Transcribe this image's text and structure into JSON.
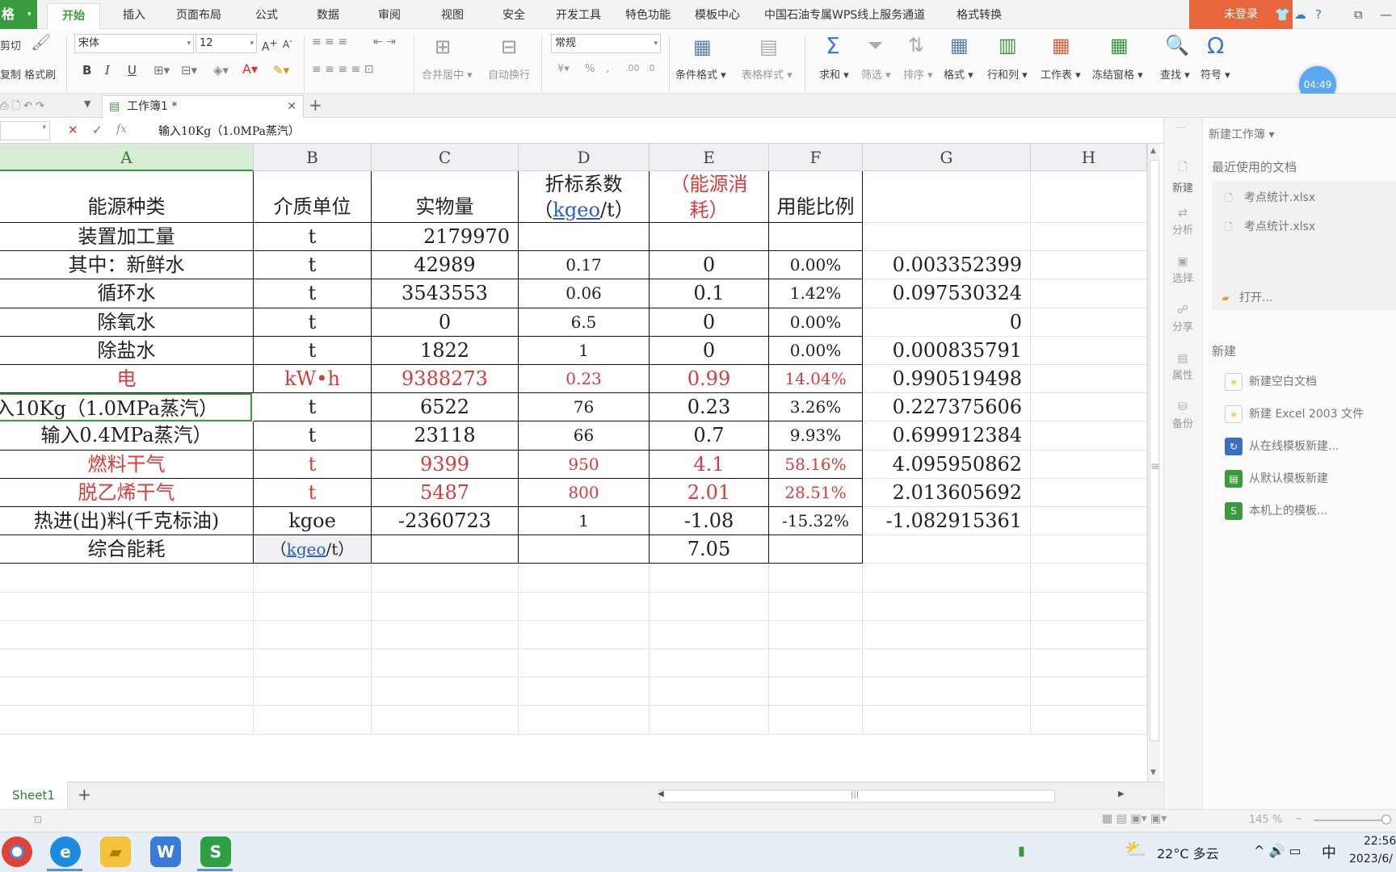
{
  "app": {
    "corner": "格",
    "login": "未登录"
  },
  "menu": [
    "开始",
    "插入",
    "页面布局",
    "公式",
    "数据",
    "审阅",
    "视图",
    "安全",
    "开发工具",
    "特色功能",
    "模板中心",
    "中国石油专属WPS线上服务通道",
    "格式转换"
  ],
  "ribbon": {
    "cut": "剪切",
    "copy": "复制",
    "format_painter": "格式刷",
    "font": "宋体",
    "size": "12",
    "number_format": "常规",
    "merge": "合并居中",
    "wrap": "自动换行",
    "cond_format": "条件格式",
    "table_style": "表格样式",
    "sum": "求和",
    "filter": "筛选",
    "sort": "排序",
    "format": "格式",
    "rowcol": "行和列",
    "sheet": "工作表",
    "freeze": "冻结窗格",
    "find": "查找",
    "symbol": "符号",
    "bold": "B",
    "italic": "I",
    "underline": "U",
    "percent": "%",
    "comma": ","
  },
  "timer": "04:49",
  "tab": {
    "doc_title": "工作簿1 *",
    "add": "+"
  },
  "formula_bar": {
    "fx": "fx",
    "value": "输入10Kg（1.0MPa蒸汽）"
  },
  "columns": [
    "A",
    "B",
    "C",
    "D",
    "E",
    "F",
    "G",
    "H"
  ],
  "header_row": {
    "a": "能源种类",
    "b": "介质单位",
    "c": "实物量",
    "d_line1": "折标系数",
    "d_pre": "（",
    "d_link": "kgeo",
    "d_post": "/t）",
    "e_line1": "（能源消",
    "e_line2": "耗）",
    "f": "用能比例"
  },
  "rows": [
    {
      "a": "装置加工量",
      "b": "t",
      "c": "2179970",
      "d": "",
      "e": "",
      "f": "",
      "g": ""
    },
    {
      "a": "其中：新鲜水",
      "b": "t",
      "c": "42989",
      "d": "0.17",
      "e": "0",
      "f": "0.00%",
      "g": "0.003352399"
    },
    {
      "a": "循环水",
      "b": "t",
      "c": "3543553",
      "d": "0.06",
      "e": "0.1",
      "f": "1.42%",
      "g": "0.097530324"
    },
    {
      "a": "除氧水",
      "b": "t",
      "c": "0",
      "d": "6.5",
      "e": "0",
      "f": "0.00%",
      "g": "0"
    },
    {
      "a": "除盐水",
      "b": "t",
      "c": "1822",
      "d": "1",
      "e": "0",
      "f": "0.00%",
      "g": "0.000835791"
    },
    {
      "a": "电",
      "b": "kW•h",
      "c": "9388273",
      "d": "0.23",
      "e": "0.99",
      "f": "14.04%",
      "g": "0.990519498"
    },
    {
      "a": "输入10Kg（1.0MPa蒸汽）",
      "b": "t",
      "c": "6522",
      "d": "76",
      "e": "0.23",
      "f": "3.26%",
      "g": "0.227375606"
    },
    {
      "a": "输入0.4MPa蒸汽）",
      "b": "t",
      "c": "23118",
      "d": "66",
      "e": "0.7",
      "f": "9.93%",
      "g": "0.699912384"
    },
    {
      "a": "燃料干气",
      "b": "t",
      "c": "9399",
      "d": "950",
      "e": "4.1",
      "f": "58.16%",
      "g": "4.095950862"
    },
    {
      "a": "脱乙烯干气",
      "b": "t",
      "c": "5487",
      "d": "800",
      "e": "2.01",
      "f": "28.51%",
      "g": "2.013605692"
    },
    {
      "a": "热进(出)料(千克标油)",
      "b": "kgoe",
      "c": "-2360723",
      "d": "1",
      "e": "-1.08",
      "f": "-15.32%",
      "g": "-1.082915361"
    }
  ],
  "total_row": {
    "a": "综合能耗",
    "b_pre": "（",
    "b_link": "kgeo",
    "b_post": "/t）",
    "e": "7.05"
  },
  "sheet": {
    "name": "Sheet1",
    "add": "+"
  },
  "status": {
    "zoom": "145 %"
  },
  "side_strip": [
    "新建",
    "分析",
    "选择",
    "分享",
    "属性",
    "备份"
  ],
  "task_pane": {
    "title": "新建工作簿",
    "recent_label": "最近使用的文档",
    "recent": [
      "考点统计.xlsx",
      "考点统计.xlsx"
    ],
    "open": "打开...",
    "new_label": "新建",
    "new_items": [
      "新建空白文档",
      "新建 Excel 2003 文件",
      "从在线模板新建...",
      "从默认模板新建",
      "本机上的模板..."
    ]
  },
  "taskbar": {
    "weather": "22°C 多云",
    "ime": "中",
    "time": "22:56",
    "date": "2023/6/"
  }
}
